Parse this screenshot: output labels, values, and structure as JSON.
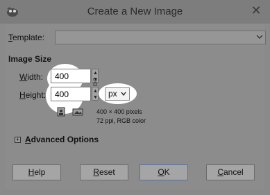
{
  "window": {
    "title": "Create a New Image",
    "close_glyph": "✕"
  },
  "template": {
    "label_u": "T",
    "label_rest": "emplate:",
    "value": ""
  },
  "image_size": {
    "heading": "Image Size",
    "width_label_u": "W",
    "width_label_rest": "idth:",
    "width_value": "400",
    "height_label_u": "H",
    "height_label_rest": "eight:",
    "height_value": "400",
    "unit": "px",
    "info_line1": "400 × 400 pixels",
    "info_line2": "72 ppi, RGB color"
  },
  "advanced": {
    "label_u": "A",
    "label_rest": "dvanced Options",
    "expander_glyph": "+"
  },
  "buttons": {
    "help_u": "H",
    "help_rest": "elp",
    "reset_u": "R",
    "reset_rest": "eset",
    "ok_u": "O",
    "ok_rest": "K",
    "cancel_u": "C",
    "cancel_rest": "ancel"
  },
  "icons": {
    "app": "gimp-icon",
    "portrait": "portrait-icon",
    "landscape": "landscape-icon",
    "chain": "chain-icon"
  }
}
